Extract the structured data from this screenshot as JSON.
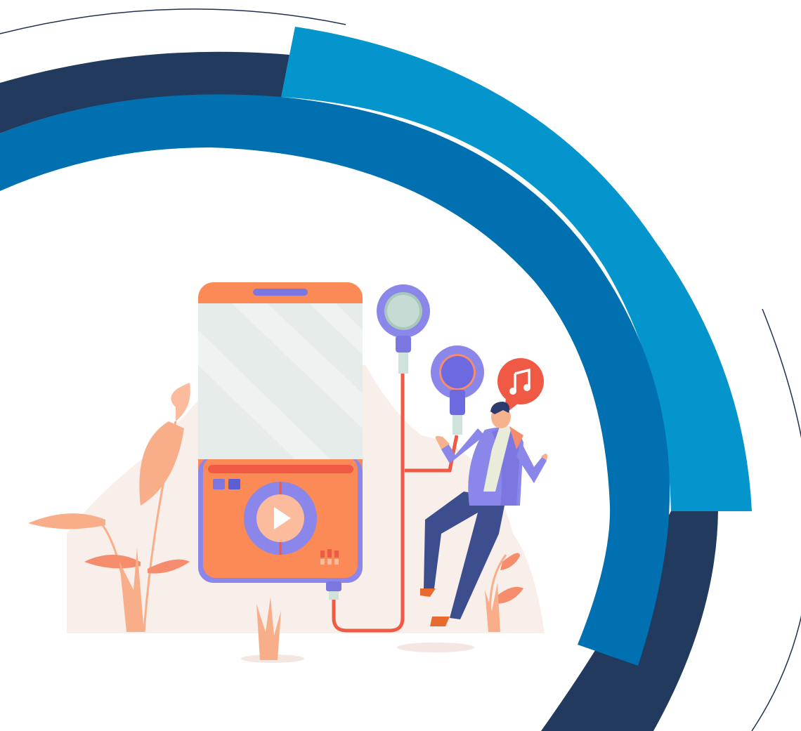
{
  "scene": {
    "subject": "music-player-illustration",
    "colors": {
      "background": "#ffffff",
      "arc_navy": "#223a5e",
      "arc_blue": "#0070b0",
      "arc_cyan": "#0395cc",
      "thin_line": "#1f3150",
      "player_orange": "#fb8a57",
      "player_screen": "#e5ecea",
      "accent_purple": "#7c77e0",
      "cable_red": "#f05a44",
      "leaf_peach": "#f9ae8a",
      "ground_blush": "#f8eeea",
      "person_navy": "#3d4e8f"
    },
    "icons": [
      "play-icon",
      "music-note-icon",
      "earbud-icon"
    ]
  }
}
